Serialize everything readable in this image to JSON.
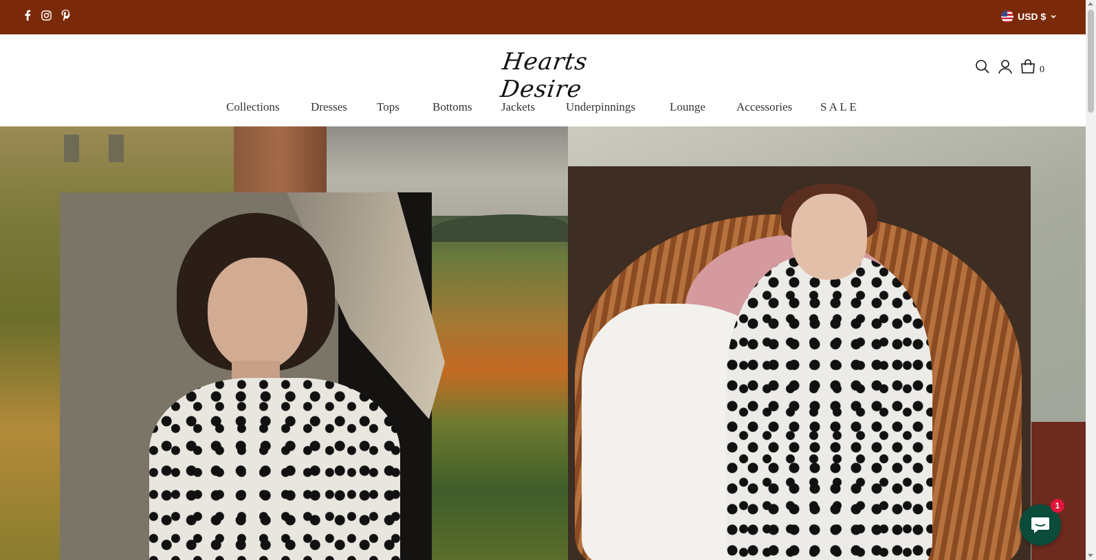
{
  "topbar": {
    "background": "#7a2a08",
    "social": [
      {
        "icon": "facebook-icon",
        "label": "f"
      },
      {
        "icon": "instagram-icon",
        "label": ""
      },
      {
        "icon": "pinterest-icon",
        "label": ""
      }
    ],
    "currency": "USD $",
    "currency_flag": "us-flag-icon"
  },
  "header": {
    "logo_text": "Hearts Desire",
    "cart_count": "0",
    "icons": [
      "search-icon",
      "account-icon",
      "cart-icon"
    ]
  },
  "nav": {
    "items": [
      "Collections",
      "Dresses",
      "Tops",
      "Bottoms",
      "Jackets",
      "Underpinnings",
      "Lounge",
      "Accessories",
      "S A L E"
    ]
  },
  "chat": {
    "badge": "1"
  }
}
